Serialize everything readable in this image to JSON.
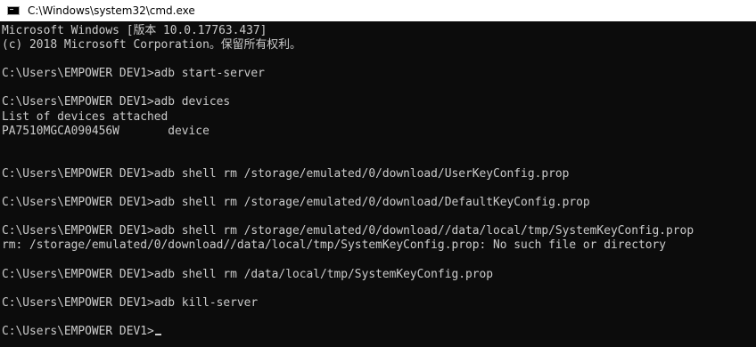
{
  "window": {
    "title": "C:\\Windows\\system32\\cmd.exe",
    "icon": "cmd-icon"
  },
  "console": {
    "lines": [
      "Microsoft Windows [版本 10.0.17763.437]",
      "(c) 2018 Microsoft Corporation。保留所有权利。",
      "",
      "C:\\Users\\EMPOWER DEV1>adb start-server",
      "",
      "C:\\Users\\EMPOWER DEV1>adb devices",
      "List of devices attached",
      "PA7510MGCA090456W       device",
      "",
      "",
      "C:\\Users\\EMPOWER DEV1>adb shell rm /storage/emulated/0/download/UserKeyConfig.prop",
      "",
      "C:\\Users\\EMPOWER DEV1>adb shell rm /storage/emulated/0/download/DefaultKeyConfig.prop",
      "",
      "C:\\Users\\EMPOWER DEV1>adb shell rm /storage/emulated/0/download//data/local/tmp/SystemKeyConfig.prop",
      "rm: /storage/emulated/0/download//data/local/tmp/SystemKeyConfig.prop: No such file or directory",
      "",
      "C:\\Users\\EMPOWER DEV1>adb shell rm /data/local/tmp/SystemKeyConfig.prop",
      "",
      "C:\\Users\\EMPOWER DEV1>adb kill-server",
      "",
      "C:\\Users\\EMPOWER DEV1>"
    ]
  }
}
